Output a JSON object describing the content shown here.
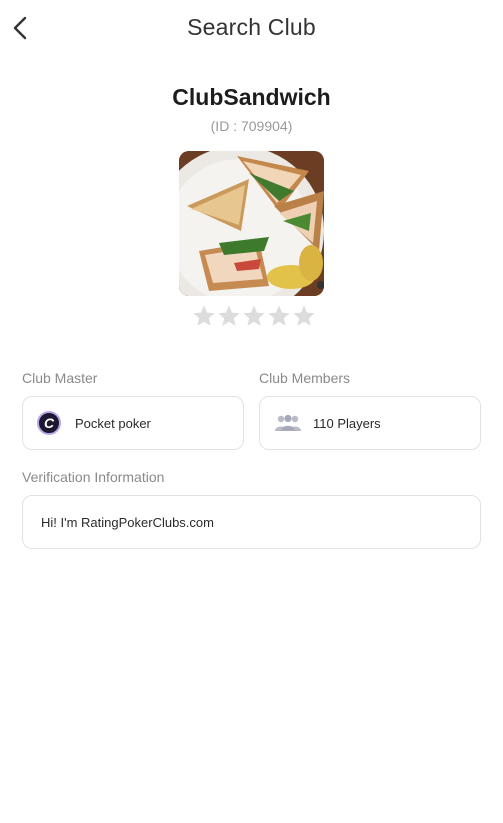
{
  "header": {
    "title": "Search Club",
    "back_icon": "chevron-left-icon"
  },
  "club": {
    "name": "ClubSandwich",
    "id_text": "(ID : 709904)",
    "rating_max": 5,
    "rating_value": 0
  },
  "master": {
    "label": "Club Master",
    "name": "Pocket poker",
    "logo_letter": "C"
  },
  "members": {
    "label": "Club Members",
    "count_text": "110 Players",
    "icon": "people-icon"
  },
  "verification": {
    "label": "Verification Information",
    "text": "Hi! I'm RatingPokerClubs.com"
  },
  "colors": {
    "border": "#e2e2e2",
    "muted": "#8a8a8a",
    "star": "#dcdcdc"
  }
}
